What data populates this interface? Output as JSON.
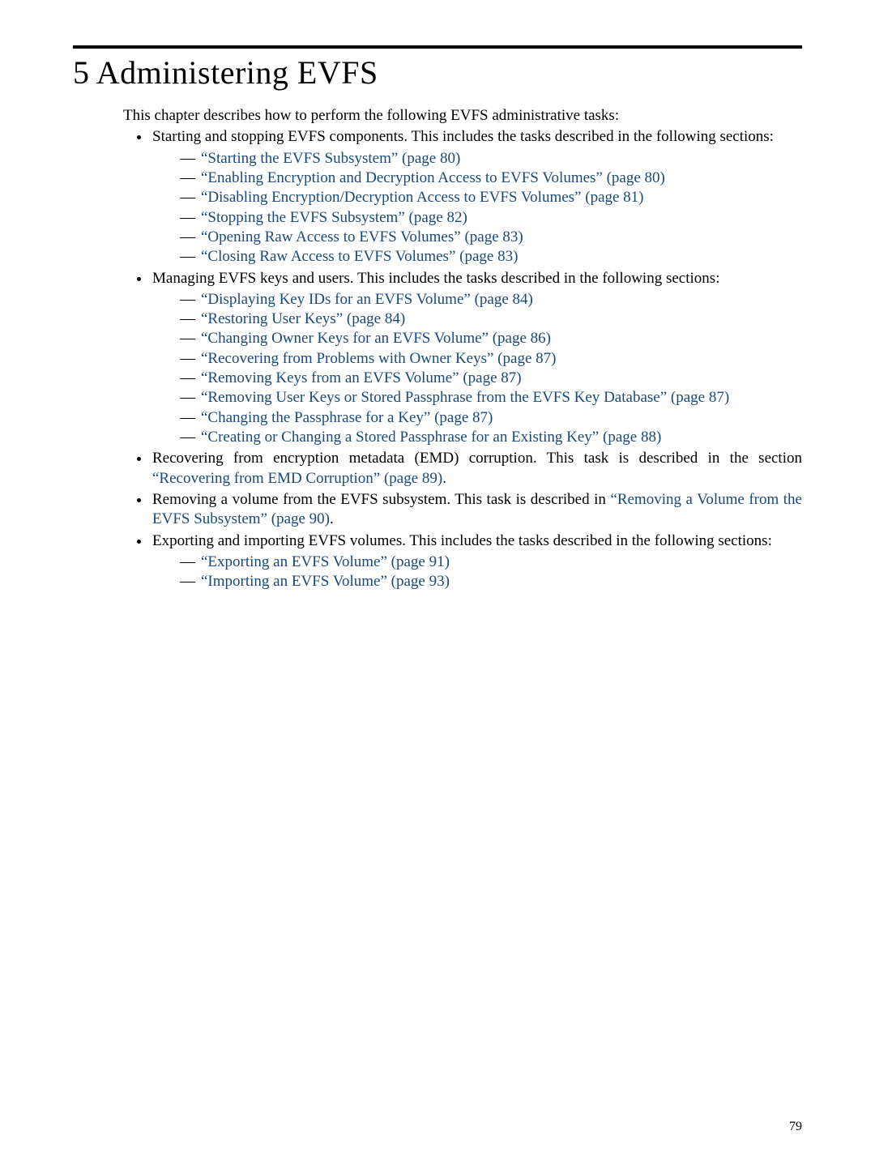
{
  "chapter": {
    "number": "5",
    "title": "Administering EVFS"
  },
  "intro": "This chapter describes how to perform the following EVFS administrative tasks:",
  "bullets": [
    {
      "text_pre": "Starting and stopping EVFS components. This includes the tasks described in the following sections:",
      "subs": [
        {
          "title": "Starting the EVFS Subsystem",
          "page": "80"
        },
        {
          "title": "Enabling Encryption and Decryption Access to EVFS Volumes",
          "page": "80"
        },
        {
          "title": "Disabling Encryption/Decryption Access to EVFS Volumes",
          "page": "81"
        },
        {
          "title": "Stopping the EVFS Subsystem",
          "page": "82"
        },
        {
          "title": "Opening Raw Access to EVFS Volumes",
          "page": "83"
        },
        {
          "title": "Closing Raw Access to EVFS Volumes",
          "page": "83"
        }
      ]
    },
    {
      "text_pre": "Managing EVFS keys and users. This includes the tasks described in the following sections:",
      "subs": [
        {
          "title": "Displaying Key IDs for an EVFS Volume",
          "page": "84"
        },
        {
          "title": "Restoring User Keys",
          "page": "84"
        },
        {
          "title": "Changing Owner Keys for an EVFS Volume",
          "page": "86"
        },
        {
          "title": "Recovering from Problems with Owner Keys",
          "page": "87"
        },
        {
          "title": "Removing Keys from an EVFS Volume",
          "page": "87"
        },
        {
          "title": "Removing User Keys or Stored Passphrase from the EVFS Key Database",
          "page": "87"
        },
        {
          "title": "Changing the Passphrase for a Key",
          "page": "87"
        },
        {
          "title": "Creating or Changing a Stored Passphrase for an Existing Key",
          "page": "88"
        }
      ]
    },
    {
      "text_pre": "Recovering from encryption metadata (EMD) corruption. This task is described in the section ",
      "inline_xref": {
        "title": "Recovering from EMD Corruption",
        "page": "89"
      },
      "text_post": "."
    },
    {
      "text_pre": "Removing a volume from the EVFS subsystem. This task is described in ",
      "inline_xref": {
        "title": "Removing a Volume from the EVFS Subsystem",
        "page": "90"
      },
      "text_post": "."
    },
    {
      "text_pre": "Exporting and importing EVFS volumes. This includes the tasks described in the following sections:",
      "subs": [
        {
          "title": "Exporting an EVFS Volume",
          "page": "91"
        },
        {
          "title": "Importing an EVFS Volume",
          "page": "93"
        }
      ]
    }
  ],
  "page_number": "79"
}
